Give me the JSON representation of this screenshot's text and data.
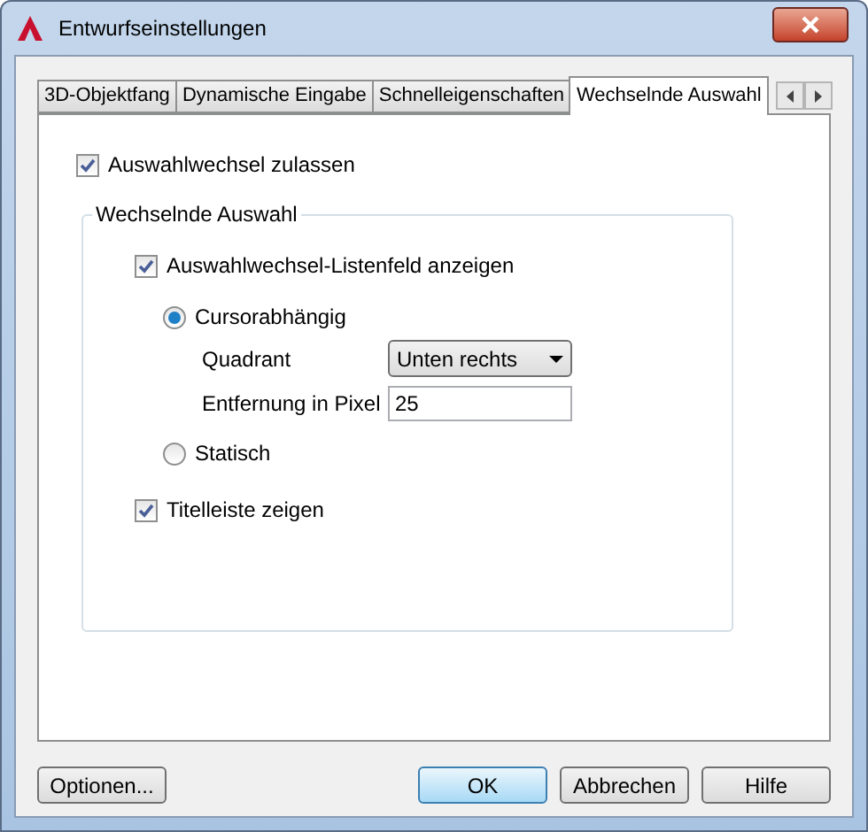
{
  "window": {
    "title": "Entwurfseinstellungen"
  },
  "tabs": [
    {
      "label": "3D-Objektfang",
      "selected": false
    },
    {
      "label": "Dynamische Eingabe",
      "selected": false
    },
    {
      "label": "Schnelleigenschaften",
      "selected": false
    },
    {
      "label": "Wechselnde Auswahl",
      "selected": true
    }
  ],
  "allow_cycling": {
    "label": "Auswahlwechsel zulassen",
    "checked": true
  },
  "group": {
    "title": "Wechselnde Auswahl",
    "show_list": {
      "label": "Auswahlwechsel-Listenfeld anzeigen",
      "checked": true
    },
    "position": [
      {
        "label": "Cursorabhängig",
        "selected": true
      },
      {
        "label": "Statisch",
        "selected": false
      }
    ],
    "quadrant": {
      "label": "Quadrant",
      "value": "Unten rechts"
    },
    "distance": {
      "label": "Entfernung in Pixel",
      "value": "25"
    },
    "show_title": {
      "label": "Titelleiste zeigen",
      "checked": true
    }
  },
  "buttons": [
    {
      "label": "Optionen...",
      "default": false
    },
    {
      "label": "OK",
      "default": true
    },
    {
      "label": "Abbrechen",
      "default": false
    },
    {
      "label": "Hilfe",
      "default": false
    }
  ]
}
